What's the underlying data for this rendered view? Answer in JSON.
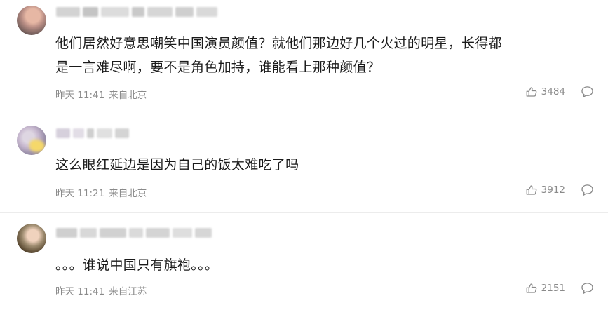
{
  "comments": [
    {
      "text": "他们居然好意思嘲笑中国演员颜值？就他们那边好几个火过的明星，长得都是一言难尽啊，要不是角色加持，谁能看上那种颜值？",
      "line1": "他们居然好意思嘲笑中国演员颜值？就他们那边好几个火过的明星，长得都",
      "line2": "是一言难尽啊，要不是角色加持，谁能看上那种颜值？",
      "time": "昨天 11:41",
      "location": "来自北京",
      "likes": "3484"
    },
    {
      "text": "这么眼红延边是因为自己的饭太难吃了吗",
      "time": "昨天 11:21",
      "location": "来自北京",
      "likes": "3912"
    },
    {
      "text": "。。。谁说中国只有旗袍。。。",
      "time": "昨天 11:41",
      "location": "来自江苏",
      "likes": "2151"
    }
  ],
  "colors": {
    "text": "#1a1a1a",
    "meta": "#8a8a8a",
    "divider": "#ececec"
  },
  "icons": {
    "like": "thumbs-up-icon",
    "reply": "comment-bubble-icon"
  }
}
